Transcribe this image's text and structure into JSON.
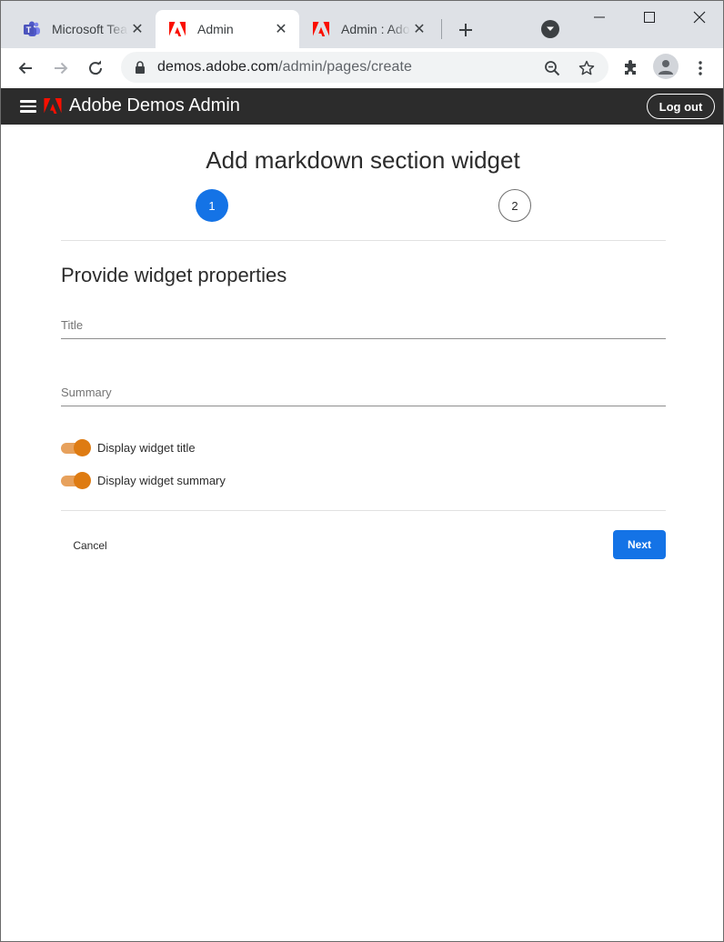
{
  "browser": {
    "tabs": [
      {
        "title": "Microsoft Teams",
        "favicon": "teams-icon",
        "active": false
      },
      {
        "title": "Admin",
        "favicon": "adobe-icon",
        "active": true
      },
      {
        "title": "Admin : Adobe",
        "favicon": "adobe-icon",
        "active": false
      }
    ],
    "url_host": "demos.adobe.com",
    "url_path": "/admin/pages/create"
  },
  "app": {
    "title": "Adobe Demos Admin",
    "logout_label": "Log out"
  },
  "wizard": {
    "title": "Add markdown section widget",
    "steps": [
      "1",
      "2"
    ],
    "current_step": 1,
    "section_title": "Provide widget properties",
    "fields": {
      "title_placeholder": "Title",
      "title_value": "",
      "summary_placeholder": "Summary",
      "summary_value": ""
    },
    "toggles": [
      {
        "label": "Display widget title",
        "on": true
      },
      {
        "label": "Display widget summary",
        "on": true
      }
    ],
    "cancel_label": "Cancel",
    "next_label": "Next"
  },
  "colors": {
    "accent_blue": "#1473e6",
    "toggle_orange": "#de7b12",
    "header_bg": "#2c2c2c",
    "adobe_red": "#fa0f00"
  }
}
